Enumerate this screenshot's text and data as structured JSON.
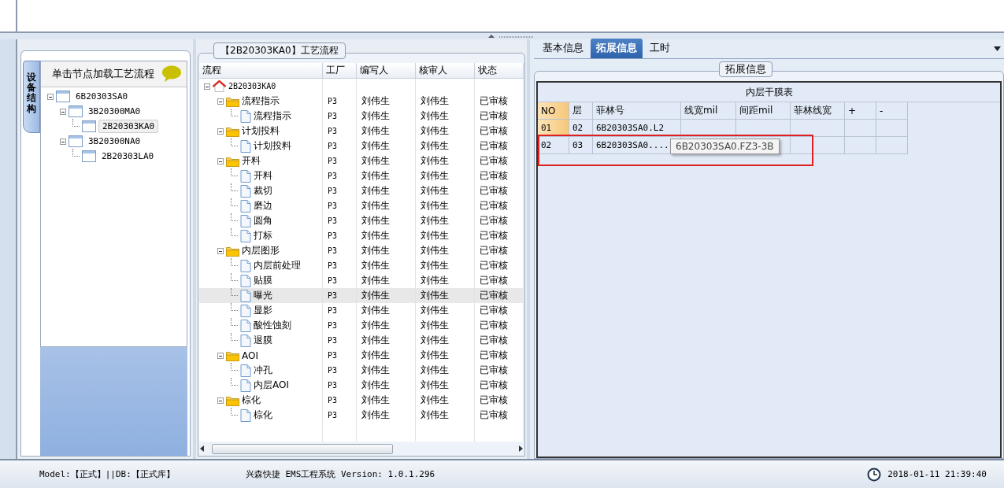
{
  "device_panel": {
    "vertical_tab": "设备结构",
    "header": "单击节点加载工艺流程",
    "tree": [
      {
        "label": "6B20303SA0",
        "expanded": true,
        "selected": false,
        "children": [
          {
            "label": "3B20300MA0",
            "expanded": true,
            "selected": false,
            "children": [
              {
                "label": "2B20303KA0",
                "selected": true
              }
            ]
          },
          {
            "label": "3B20300NA0",
            "expanded": true,
            "selected": false,
            "children": [
              {
                "label": "2B20303LA0",
                "selected": false
              }
            ]
          }
        ]
      }
    ]
  },
  "flow_panel": {
    "title": "【2B20303KA0】工艺流程",
    "columns": [
      "流程",
      "工厂",
      "编写人",
      "核审人",
      "状态"
    ],
    "tree": [
      {
        "kind": "root",
        "label": "2B20303KA0",
        "expanded": true,
        "selected": false,
        "children": [
          {
            "kind": "folder",
            "label": "流程指示",
            "factory": "P3",
            "writer": "刘伟生",
            "reviewer": "刘伟生",
            "status": "已审核",
            "expanded": true,
            "selected": false,
            "children": [
              {
                "kind": "step",
                "label": "流程指示",
                "factory": "P3",
                "writer": "刘伟生",
                "reviewer": "刘伟生",
                "status": "已审核",
                "selected": false
              }
            ]
          },
          {
            "kind": "folder",
            "label": "计划投料",
            "factory": "P3",
            "writer": "刘伟生",
            "reviewer": "刘伟生",
            "status": "已审核",
            "expanded": true,
            "selected": false,
            "children": [
              {
                "kind": "step",
                "label": "计划投料",
                "factory": "P3",
                "writer": "刘伟生",
                "reviewer": "刘伟生",
                "status": "已审核",
                "selected": false
              }
            ]
          },
          {
            "kind": "folder",
            "label": "开料",
            "factory": "P3",
            "writer": "刘伟生",
            "reviewer": "刘伟生",
            "status": "已审核",
            "expanded": true,
            "selected": false,
            "children": [
              {
                "kind": "step",
                "label": "开料",
                "factory": "P3",
                "writer": "刘伟生",
                "reviewer": "刘伟生",
                "status": "已审核",
                "selected": false
              },
              {
                "kind": "step",
                "label": "裁切",
                "factory": "P3",
                "writer": "刘伟生",
                "reviewer": "刘伟生",
                "status": "已审核",
                "selected": false
              },
              {
                "kind": "step",
                "label": "磨边",
                "factory": "P3",
                "writer": "刘伟生",
                "reviewer": "刘伟生",
                "status": "已审核",
                "selected": false
              },
              {
                "kind": "step",
                "label": "圆角",
                "factory": "P3",
                "writer": "刘伟生",
                "reviewer": "刘伟生",
                "status": "已审核",
                "selected": false
              },
              {
                "kind": "step",
                "label": "打标",
                "factory": "P3",
                "writer": "刘伟生",
                "reviewer": "刘伟生",
                "status": "已审核",
                "selected": false
              }
            ]
          },
          {
            "kind": "folder",
            "label": "内层图形",
            "factory": "P3",
            "writer": "刘伟生",
            "reviewer": "刘伟生",
            "status": "已审核",
            "expanded": true,
            "selected": false,
            "children": [
              {
                "kind": "step",
                "label": "内层前处理",
                "factory": "P3",
                "writer": "刘伟生",
                "reviewer": "刘伟生",
                "status": "已审核",
                "selected": false
              },
              {
                "kind": "step",
                "label": "贴膜",
                "factory": "P3",
                "writer": "刘伟生",
                "reviewer": "刘伟生",
                "status": "已审核",
                "selected": false
              },
              {
                "kind": "step",
                "label": "曝光",
                "factory": "P3",
                "writer": "刘伟生",
                "reviewer": "刘伟生",
                "status": "已审核",
                "selected": true
              },
              {
                "kind": "step",
                "label": "显影",
                "factory": "P3",
                "writer": "刘伟生",
                "reviewer": "刘伟生",
                "status": "已审核",
                "selected": false
              },
              {
                "kind": "step",
                "label": "酸性蚀刻",
                "factory": "P3",
                "writer": "刘伟生",
                "reviewer": "刘伟生",
                "status": "已审核",
                "selected": false
              },
              {
                "kind": "step",
                "label": "退膜",
                "factory": "P3",
                "writer": "刘伟生",
                "reviewer": "刘伟生",
                "status": "已审核",
                "selected": false
              }
            ]
          },
          {
            "kind": "folder",
            "label": "AOI",
            "factory": "P3",
            "writer": "刘伟生",
            "reviewer": "刘伟生",
            "status": "已审核",
            "expanded": true,
            "selected": false,
            "children": [
              {
                "kind": "step",
                "label": "冲孔",
                "factory": "P3",
                "writer": "刘伟生",
                "reviewer": "刘伟生",
                "status": "已审核",
                "selected": false
              },
              {
                "kind": "step",
                "label": "内层AOI",
                "factory": "P3",
                "writer": "刘伟生",
                "reviewer": "刘伟生",
                "status": "已审核",
                "selected": false
              }
            ]
          },
          {
            "kind": "folder",
            "label": "棕化",
            "factory": "P3",
            "writer": "刘伟生",
            "reviewer": "刘伟生",
            "status": "已审核",
            "expanded": true,
            "selected": false,
            "children": [
              {
                "kind": "step",
                "label": "棕化",
                "factory": "P3",
                "writer": "刘伟生",
                "reviewer": "刘伟生",
                "status": "已审核",
                "selected": false
              }
            ]
          }
        ]
      }
    ]
  },
  "detail_panel": {
    "tabs": [
      {
        "label": "基本信息",
        "selected": false
      },
      {
        "label": "拓展信息",
        "selected": true
      },
      {
        "label": "工时",
        "selected": false
      }
    ],
    "group_title": "拓展信息",
    "table": {
      "caption": "内层干膜表",
      "columns": [
        "NO",
        "层",
        "菲林号",
        "线宽mil",
        "间距mil",
        "菲林线宽",
        "+",
        "-"
      ],
      "rows": [
        {
          "no": "01",
          "layer": "02",
          "film": "6B20303SA0.L2",
          "selected": true
        },
        {
          "no": "02",
          "layer": "03",
          "film": "6B20303SA0....",
          "selected": false
        }
      ]
    },
    "tooltip": "6B20303SA0.FZ3-3B"
  },
  "status_bar": {
    "model": "Model:【正式】||DB:【正式库】",
    "system": "兴森快捷 EMS工程系统 Version: 1.0.1.296",
    "datetime": "2018-01-11 21:39:40"
  }
}
